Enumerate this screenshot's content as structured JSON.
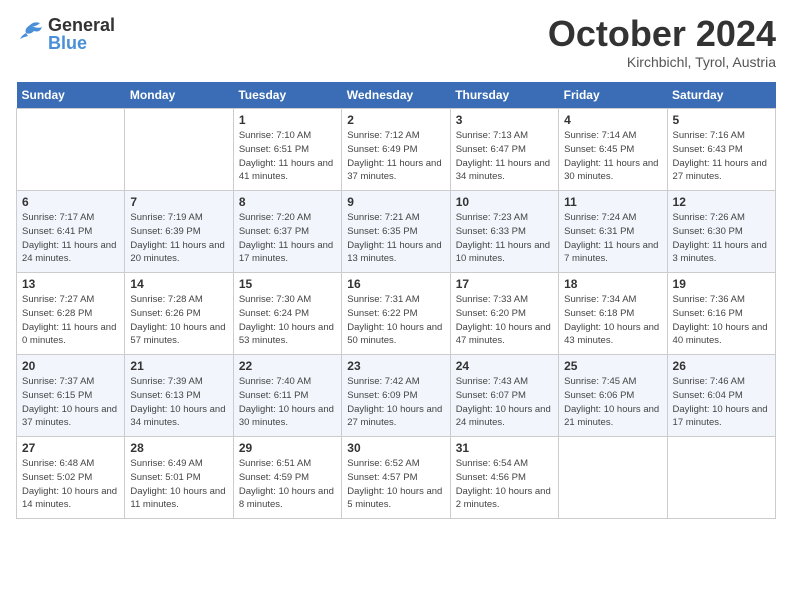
{
  "header": {
    "logo_general": "General",
    "logo_blue": "Blue",
    "month_title": "October 2024",
    "subtitle": "Kirchbichl, Tyrol, Austria"
  },
  "days_of_week": [
    "Sunday",
    "Monday",
    "Tuesday",
    "Wednesday",
    "Thursday",
    "Friday",
    "Saturday"
  ],
  "weeks": [
    [
      {
        "day": "",
        "info": ""
      },
      {
        "day": "",
        "info": ""
      },
      {
        "day": "1",
        "info": "Sunrise: 7:10 AM\nSunset: 6:51 PM\nDaylight: 11 hours and 41 minutes."
      },
      {
        "day": "2",
        "info": "Sunrise: 7:12 AM\nSunset: 6:49 PM\nDaylight: 11 hours and 37 minutes."
      },
      {
        "day": "3",
        "info": "Sunrise: 7:13 AM\nSunset: 6:47 PM\nDaylight: 11 hours and 34 minutes."
      },
      {
        "day": "4",
        "info": "Sunrise: 7:14 AM\nSunset: 6:45 PM\nDaylight: 11 hours and 30 minutes."
      },
      {
        "day": "5",
        "info": "Sunrise: 7:16 AM\nSunset: 6:43 PM\nDaylight: 11 hours and 27 minutes."
      }
    ],
    [
      {
        "day": "6",
        "info": "Sunrise: 7:17 AM\nSunset: 6:41 PM\nDaylight: 11 hours and 24 minutes."
      },
      {
        "day": "7",
        "info": "Sunrise: 7:19 AM\nSunset: 6:39 PM\nDaylight: 11 hours and 20 minutes."
      },
      {
        "day": "8",
        "info": "Sunrise: 7:20 AM\nSunset: 6:37 PM\nDaylight: 11 hours and 17 minutes."
      },
      {
        "day": "9",
        "info": "Sunrise: 7:21 AM\nSunset: 6:35 PM\nDaylight: 11 hours and 13 minutes."
      },
      {
        "day": "10",
        "info": "Sunrise: 7:23 AM\nSunset: 6:33 PM\nDaylight: 11 hours and 10 minutes."
      },
      {
        "day": "11",
        "info": "Sunrise: 7:24 AM\nSunset: 6:31 PM\nDaylight: 11 hours and 7 minutes."
      },
      {
        "day": "12",
        "info": "Sunrise: 7:26 AM\nSunset: 6:30 PM\nDaylight: 11 hours and 3 minutes."
      }
    ],
    [
      {
        "day": "13",
        "info": "Sunrise: 7:27 AM\nSunset: 6:28 PM\nDaylight: 11 hours and 0 minutes."
      },
      {
        "day": "14",
        "info": "Sunrise: 7:28 AM\nSunset: 6:26 PM\nDaylight: 10 hours and 57 minutes."
      },
      {
        "day": "15",
        "info": "Sunrise: 7:30 AM\nSunset: 6:24 PM\nDaylight: 10 hours and 53 minutes."
      },
      {
        "day": "16",
        "info": "Sunrise: 7:31 AM\nSunset: 6:22 PM\nDaylight: 10 hours and 50 minutes."
      },
      {
        "day": "17",
        "info": "Sunrise: 7:33 AM\nSunset: 6:20 PM\nDaylight: 10 hours and 47 minutes."
      },
      {
        "day": "18",
        "info": "Sunrise: 7:34 AM\nSunset: 6:18 PM\nDaylight: 10 hours and 43 minutes."
      },
      {
        "day": "19",
        "info": "Sunrise: 7:36 AM\nSunset: 6:16 PM\nDaylight: 10 hours and 40 minutes."
      }
    ],
    [
      {
        "day": "20",
        "info": "Sunrise: 7:37 AM\nSunset: 6:15 PM\nDaylight: 10 hours and 37 minutes."
      },
      {
        "day": "21",
        "info": "Sunrise: 7:39 AM\nSunset: 6:13 PM\nDaylight: 10 hours and 34 minutes."
      },
      {
        "day": "22",
        "info": "Sunrise: 7:40 AM\nSunset: 6:11 PM\nDaylight: 10 hours and 30 minutes."
      },
      {
        "day": "23",
        "info": "Sunrise: 7:42 AM\nSunset: 6:09 PM\nDaylight: 10 hours and 27 minutes."
      },
      {
        "day": "24",
        "info": "Sunrise: 7:43 AM\nSunset: 6:07 PM\nDaylight: 10 hours and 24 minutes."
      },
      {
        "day": "25",
        "info": "Sunrise: 7:45 AM\nSunset: 6:06 PM\nDaylight: 10 hours and 21 minutes."
      },
      {
        "day": "26",
        "info": "Sunrise: 7:46 AM\nSunset: 6:04 PM\nDaylight: 10 hours and 17 minutes."
      }
    ],
    [
      {
        "day": "27",
        "info": "Sunrise: 6:48 AM\nSunset: 5:02 PM\nDaylight: 10 hours and 14 minutes."
      },
      {
        "day": "28",
        "info": "Sunrise: 6:49 AM\nSunset: 5:01 PM\nDaylight: 10 hours and 11 minutes."
      },
      {
        "day": "29",
        "info": "Sunrise: 6:51 AM\nSunset: 4:59 PM\nDaylight: 10 hours and 8 minutes."
      },
      {
        "day": "30",
        "info": "Sunrise: 6:52 AM\nSunset: 4:57 PM\nDaylight: 10 hours and 5 minutes."
      },
      {
        "day": "31",
        "info": "Sunrise: 6:54 AM\nSunset: 4:56 PM\nDaylight: 10 hours and 2 minutes."
      },
      {
        "day": "",
        "info": ""
      },
      {
        "day": "",
        "info": ""
      }
    ]
  ]
}
